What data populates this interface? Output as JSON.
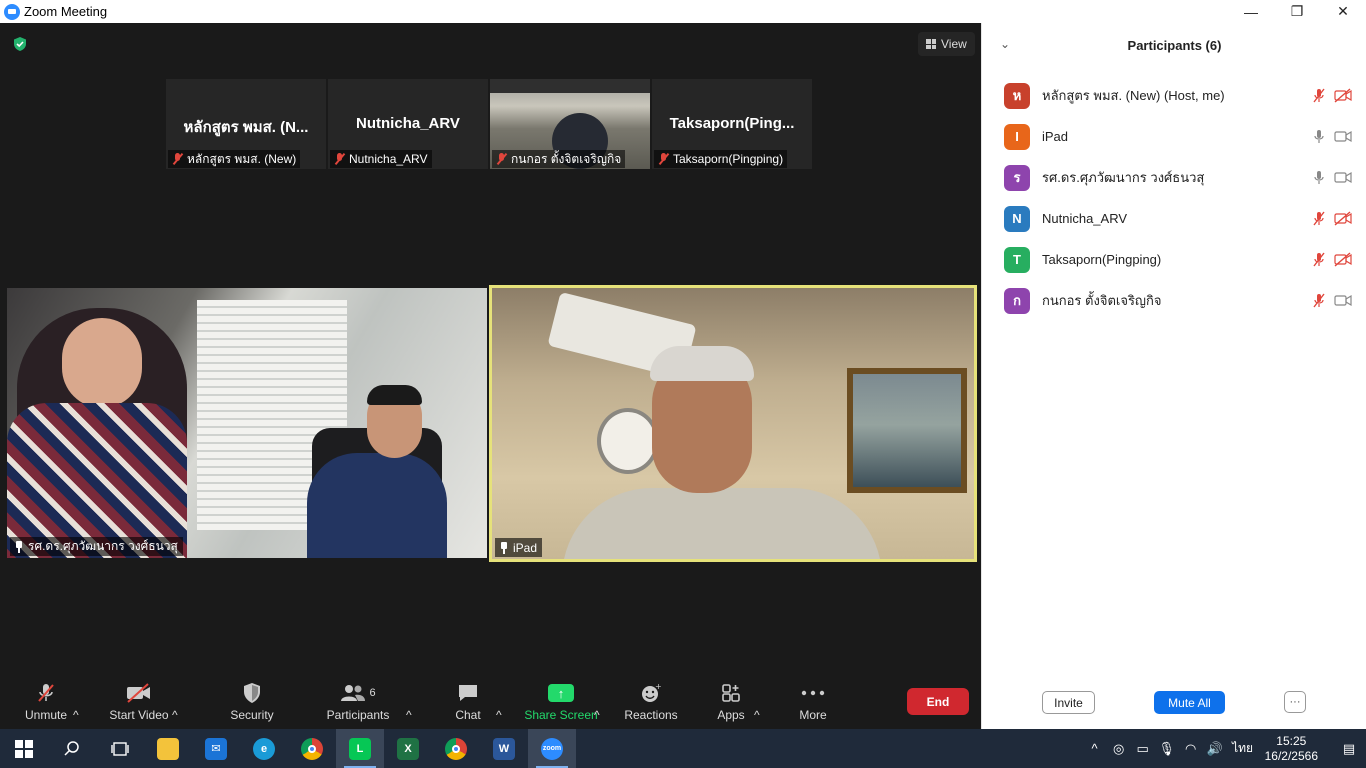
{
  "window": {
    "title": "Zoom Meeting",
    "controls": {
      "minimize": "—",
      "restore": "❐",
      "close": "✕"
    }
  },
  "meeting": {
    "view_label": "View",
    "thumbnails": [
      {
        "display_name": "หลักสูตร พมส. (N...",
        "label": "หลักสูตร พมส. (New)",
        "muted": true,
        "video": false
      },
      {
        "display_name": "Nutnicha_ARV",
        "label": "Nutnicha_ARV",
        "muted": true,
        "video": false
      },
      {
        "display_name": "",
        "label": "กนกอร ตั้งจิตเจริญกิจ",
        "muted": true,
        "video": true
      },
      {
        "display_name": "Taksaporn(Ping...",
        "label": "Taksaporn(Pingping)",
        "muted": true,
        "video": false
      }
    ],
    "main_tiles": [
      {
        "label": "รศ.ดร.ศุภวัฒนากร วงศ์ธนวสุ",
        "active_speaker": false
      },
      {
        "label": "iPad",
        "active_speaker": true
      }
    ]
  },
  "toolbar": {
    "unmute": "Unmute",
    "start_video": "Start Video",
    "security": "Security",
    "participants": "Participants",
    "participants_count": "6",
    "chat": "Chat",
    "share_screen": "Share Screen",
    "reactions": "Reactions",
    "apps": "Apps",
    "more": "More",
    "end": "End",
    "colors": {
      "share": "#23d96b",
      "end": "#d0282f"
    }
  },
  "panel": {
    "title": "Participants (6)",
    "participants": [
      {
        "initial": "ห",
        "name": "หลักสูตร พมส. (New) (Host, me)",
        "color": "#c8412c",
        "mic_on": false,
        "cam_on": false
      },
      {
        "initial": "I",
        "name": "iPad",
        "color": "#e8661a",
        "mic_on": true,
        "cam_on": true
      },
      {
        "initial": "ร",
        "name": "รศ.ดร.ศุภวัฒนากร วงศ์ธนวสุ",
        "color": "#8e44ad",
        "mic_on": true,
        "cam_on": true
      },
      {
        "initial": "N",
        "name": "Nutnicha_ARV",
        "color": "#2a7bbf",
        "mic_on": false,
        "cam_on": false
      },
      {
        "initial": "T",
        "name": "Taksaporn(Pingping)",
        "color": "#27ae60",
        "mic_on": false,
        "cam_on": false
      },
      {
        "initial": "ก",
        "name": "กนกอร ตั้งจิตเจริญกิจ",
        "color": "#8e44ad",
        "mic_on": false,
        "cam_on": true
      }
    ],
    "invite": "Invite",
    "mute_all": "Mute All",
    "more": "···"
  },
  "taskbar": {
    "apps": [
      "start-icon",
      "search-icon",
      "task-view-icon",
      "file-explorer-icon",
      "mail-icon",
      "edge-icon",
      "chrome-icon",
      "line-icon",
      "excel-icon",
      "chrome-icon",
      "word-icon",
      "zoom-icon"
    ],
    "language": "ไทย",
    "time": "15:25",
    "date": "16/2/2566"
  }
}
